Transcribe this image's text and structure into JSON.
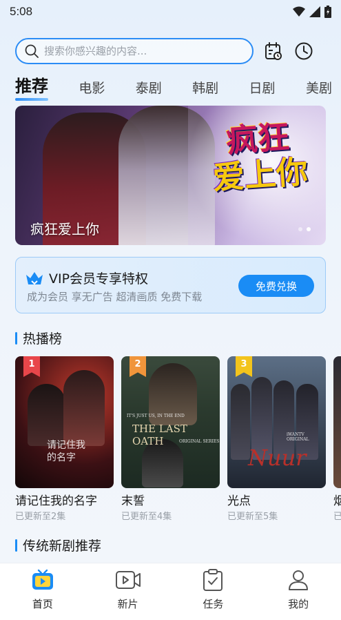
{
  "status_bar": {
    "time": "5:08"
  },
  "search": {
    "placeholder": "搜索你感兴趣的内容..."
  },
  "header_icons": [
    "calendar-icon",
    "history-clock-icon"
  ],
  "tabs": [
    {
      "label": "推荐",
      "active": true
    },
    {
      "label": "电影"
    },
    {
      "label": "泰剧"
    },
    {
      "label": "韩剧"
    },
    {
      "label": "日剧"
    },
    {
      "label": "美剧"
    }
  ],
  "banner": {
    "title": "疯狂爱上你",
    "logo_line1": "疯狂",
    "logo_line2": "爱上你",
    "slide_count": 2,
    "active_slide": 2
  },
  "vip": {
    "title": "VIP会员专享特权",
    "subtitle": "成为会员 享无广告 超清画质 免费下载",
    "button": "免费兑换"
  },
  "hot": {
    "heading": "热播榜",
    "items": [
      {
        "rank": "1",
        "title": "请记住我的名字",
        "sub": "已更新至2集",
        "poster_text": "请记住我的名字"
      },
      {
        "rank": "2",
        "title": "末誓",
        "sub": "已更新至4集",
        "poster_text": "THE LAST OATH",
        "poster_text2": "IT'S JUST US, IN THE END",
        "poster_text3": "ORIGINAL SERIES"
      },
      {
        "rank": "3",
        "title": "光点",
        "sub": "已更新至5集",
        "poster_text": "Nuur",
        "poster_text2": "iWANTV ORIGINAL"
      },
      {
        "rank": "",
        "title": "烟",
        "sub": "已"
      }
    ]
  },
  "section2": {
    "heading": "传统新剧推荐"
  },
  "bottom_nav": [
    {
      "label": "首页",
      "icon": "tv-icon",
      "active": true
    },
    {
      "label": "新片",
      "icon": "video-camera-icon"
    },
    {
      "label": "任务",
      "icon": "clipboard-check-icon"
    },
    {
      "label": "我的",
      "icon": "user-icon"
    }
  ],
  "colors": {
    "accent": "#1a8cf5",
    "rank1": "#e8464a",
    "rank2": "#f0953b",
    "rank3": "#f3c41c"
  }
}
